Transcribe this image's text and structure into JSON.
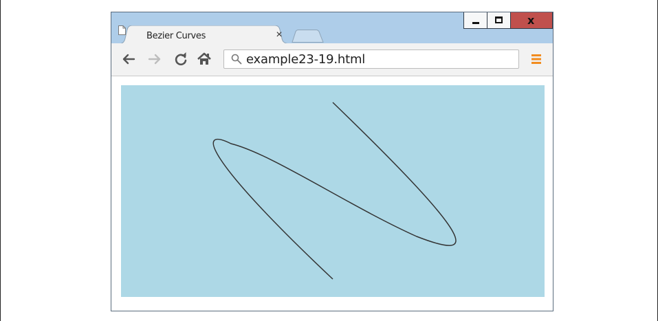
{
  "browser": {
    "tab": {
      "title": "Bezier Curves",
      "close_glyph": "×"
    },
    "new_tab_label": "",
    "window_controls": {
      "minimize": "minimize-icon",
      "maximize": "maximize-icon",
      "close_glyph": "x",
      "close_color": "#c0504d"
    },
    "address": {
      "url": "example23-19.html"
    },
    "toolbar_icons": [
      "back-arrow-icon",
      "forward-arrow-icon",
      "reload-icon",
      "home-icon",
      "search-icon",
      "menu-icon"
    ],
    "menu_color": "#f28c1f",
    "frame_color": "#aecde9"
  },
  "canvas": {
    "background": "#add8e6",
    "stroke_color": "#333333"
  }
}
